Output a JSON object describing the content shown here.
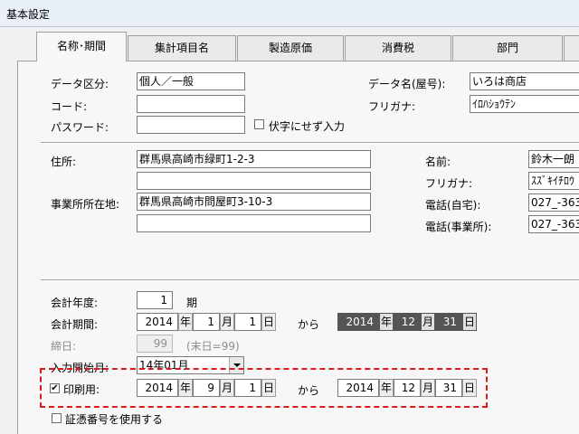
{
  "window": {
    "title": "基本設定"
  },
  "tabs": [
    "名称･期間",
    "集計項目名",
    "製造原価",
    "消費税",
    "部門"
  ],
  "basic": {
    "data_kubun_label": "データ区分:",
    "data_kubun_value": "個人／一般",
    "code_label": "コード:",
    "code_value": "",
    "password_label": "パスワード:",
    "password_value": "",
    "hide_label": "伏字にせず入力",
    "data_name_label": "データ名(屋号):",
    "data_name_value": "いろは商店",
    "furigana_label": "フリガナ:",
    "furigana_value": "ｲﾛﾊｼｮｳﾃﾝ"
  },
  "address": {
    "jusho_label": "住所:",
    "jusho1": "群馬県高崎市緑町1-2-3",
    "jusho2": "",
    "jigyo_label": "事業所所在地:",
    "jigyo1": "群馬県高崎市問屋町3-10-3",
    "jigyo2": "",
    "name_label": "名前:",
    "name_value": "鈴木一朗",
    "kana_label": "フリガナ:",
    "kana_value": "ｽｽﾞｷｲﾁﾛｳ",
    "tel_home_label": "電話(自宅):",
    "tel_home_value": "027_-363",
    "tel_office_label": "電話(事業所):",
    "tel_office_value": "027_-363"
  },
  "period": {
    "fiscal_year_label": "会計年度:",
    "fiscal_year_value": "1",
    "ki": "期",
    "kikan_label": "会計期間:",
    "from": {
      "y": "2014",
      "m": "1",
      "d": "1"
    },
    "kara": "から",
    "to": {
      "y": "2014",
      "m": "12",
      "d": "31"
    },
    "shimebi_label": "締日:",
    "shimebi_value": "99",
    "shimebi_note": "(末日=99)",
    "nyuryoku_label": "入力開始月:",
    "nyuryoku_value": "14年01月",
    "print_label": "印刷用:",
    "print_checked": "✔",
    "print_from": {
      "y": "2014",
      "m": "9",
      "d": "1"
    },
    "print_to": {
      "y": "2014",
      "m": "12",
      "d": "31"
    },
    "shohyo_label": "証憑番号を使用する"
  },
  "units": {
    "year": "年",
    "month": "月",
    "day": "日"
  }
}
